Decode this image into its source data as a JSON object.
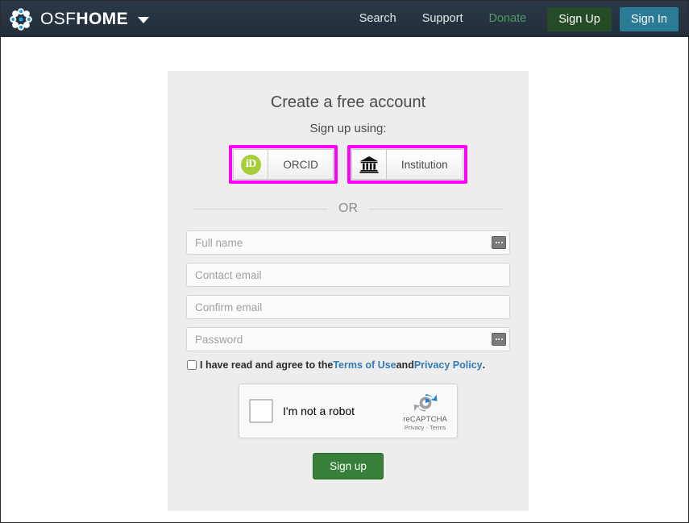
{
  "navbar": {
    "logo_icon": "osf-flower-logo",
    "brand_light": "OSF",
    "brand_bold": "HOME",
    "caret_icon": "chevron-down-icon",
    "links": [
      {
        "label": "Search",
        "name": "search"
      },
      {
        "label": "Support",
        "name": "support"
      },
      {
        "label": "Donate",
        "name": "donate"
      }
    ],
    "signup_label": "Sign Up",
    "signin_label": "Sign In",
    "colors": {
      "background": "#263341",
      "donate_text": "#4f9a5f",
      "signup_button": "#254b26",
      "signin_button": "#2a7b96"
    }
  },
  "panel": {
    "title": "Create a free account",
    "subtitle": "Sign up using:",
    "highlight_color": "#ff00ff",
    "providers": [
      {
        "label": "ORCID",
        "icon": "orcid-id-icon",
        "badge_text": "iD",
        "badge_color": "#a6ce39",
        "highlighted": true
      },
      {
        "label": "Institution",
        "icon": "institution-building-icon",
        "highlighted": true
      }
    ],
    "divider_text": "OR",
    "fields": [
      {
        "name": "full-name",
        "placeholder": "Full name",
        "value": "",
        "type": "text",
        "autofill_icon": true
      },
      {
        "name": "contact-email",
        "placeholder": "Contact email",
        "value": "",
        "type": "text",
        "autofill_icon": false
      },
      {
        "name": "confirm-email",
        "placeholder": "Confirm email",
        "value": "",
        "type": "text",
        "autofill_icon": false
      },
      {
        "name": "password",
        "placeholder": "Password",
        "value": "",
        "type": "password",
        "autofill_icon": true
      }
    ],
    "terms": {
      "checked": false,
      "text_before": "I have read and agree to the ",
      "link_terms": "Terms of Use",
      "text_between": " and ",
      "link_privacy": "Privacy Policy",
      "text_after": ".",
      "link_color": "#337ab7"
    },
    "recaptcha": {
      "label": "I'm not a robot",
      "checked": false,
      "brand": "reCAPTCHA",
      "links": "Privacy - Terms",
      "logo_icon": "recaptcha-arrows-icon"
    },
    "submit_label": "Sign up",
    "submit_color": "#368039"
  }
}
